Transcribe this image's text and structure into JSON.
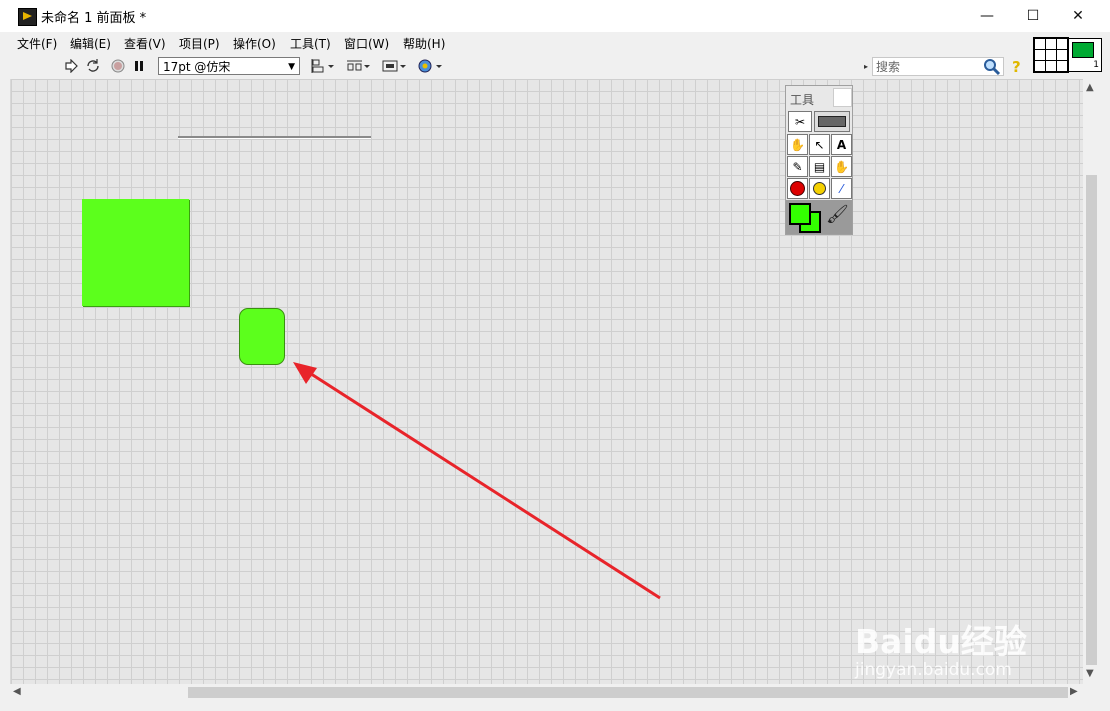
{
  "window": {
    "title": "未命名 1 前面板 *"
  },
  "window_controls": {
    "minimize": "—",
    "maximize": "☐",
    "close": "✕"
  },
  "menu": [
    {
      "label": "文件(F)"
    },
    {
      "label": "编辑(E)"
    },
    {
      "label": "查看(V)"
    },
    {
      "label": "项目(P)"
    },
    {
      "label": "操作(O)"
    },
    {
      "label": "工具(T)"
    },
    {
      "label": "窗口(W)"
    },
    {
      "label": "帮助(H)"
    }
  ],
  "toolbar": {
    "run_icon": "run-arrow-icon",
    "run_continuous_icon": "run-continuously-icon",
    "abort_icon": "abort-icon",
    "pause_icon": "pause-icon",
    "font_value": "17pt @仿宋",
    "align_icon": "align-objects-icon",
    "distribute_icon": "distribute-objects-icon",
    "resize_icon": "resize-objects-icon",
    "reorder_icon": "reorder-icon"
  },
  "search": {
    "placeholder": "搜索"
  },
  "tools_palette": {
    "title": "工具",
    "cells": [
      "auto-tool",
      "operate-value",
      "position-size",
      "edit-text",
      "connect-wire",
      "object-shortcut",
      "scroll-window",
      "breakpoint",
      "probe-data",
      "get-color",
      "set-color",
      "paintbrush"
    ]
  },
  "colors": {
    "green": "#5cff1c",
    "canvas": "#e6e6e6",
    "grid": "#cfcfcf",
    "arrow": "#e8242a"
  },
  "watermark": {
    "brand": "Baidu经验",
    "url": "jingyan.baidu.com"
  },
  "vi_icon": {
    "number": "1"
  }
}
